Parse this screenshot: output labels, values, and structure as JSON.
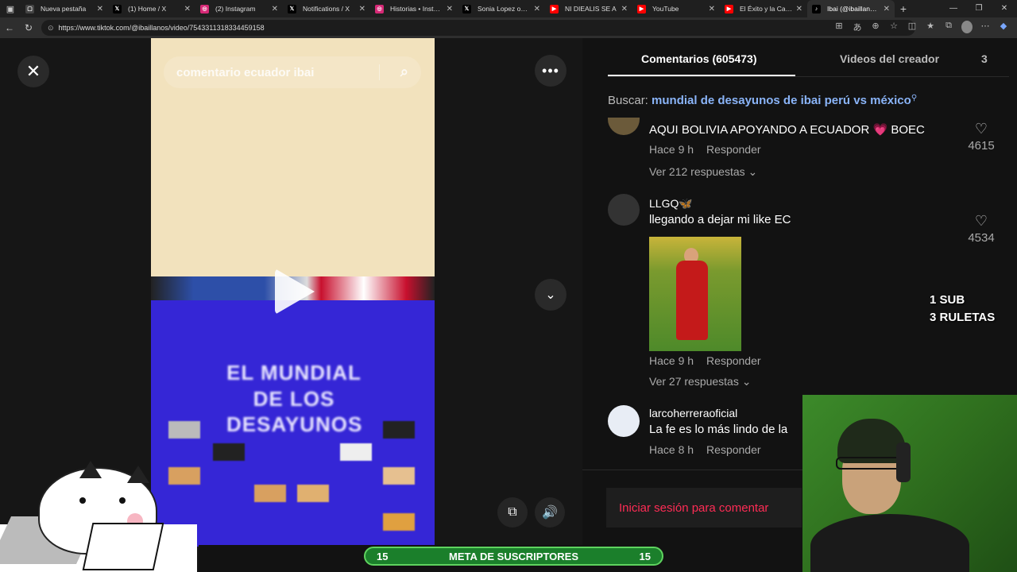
{
  "browser": {
    "tabs": [
      {
        "title": "Nueva pestaña",
        "icon": "new-tab",
        "color": "#444"
      },
      {
        "title": "(1) Home / X",
        "icon": "x",
        "color": "#000"
      },
      {
        "title": "(2) Instagram",
        "icon": "instagram",
        "color": "#d62976"
      },
      {
        "title": "Notifications / X",
        "icon": "x",
        "color": "#000"
      },
      {
        "title": "Historias • Instagram",
        "icon": "instagram",
        "color": "#d62976"
      },
      {
        "title": "Sonia Lopez on X:",
        "icon": "x",
        "color": "#000"
      },
      {
        "title": "NI DIEALIS SE A",
        "icon": "youtube",
        "color": "#ff0000"
      },
      {
        "title": "YouTube",
        "icon": "youtube",
        "color": "#ff0000"
      },
      {
        "title": "El Éxito y la Caída d",
        "icon": "youtube",
        "color": "#ff0000"
      },
      {
        "title": "Ibai (@ibaillanos) |",
        "icon": "tiktok",
        "color": "#000"
      }
    ],
    "url": "https://www.tiktok.com/@ibaillanos/video/7543311318334459158"
  },
  "video": {
    "search_text": "comentario ecuador ibai",
    "overlay_title": "EL MUNDIAL DE LOS DESAYUNOS"
  },
  "comments_panel": {
    "tab_comments": "Comentarios (605473)",
    "tab_creator_videos": "Videos del creador",
    "tab_extra": "3",
    "search_label": "Buscar: ",
    "search_query": "mundial de desayunos de ibai perú vs méxico",
    "comments": [
      {
        "name": "",
        "text": "AQUI BOLIVIA APOYANDO A ECUADOR 💗 BOEC",
        "time": "Hace 9 h",
        "reply": "Responder",
        "likes": "4615",
        "replies": "Ver 212 respuestas ⌄"
      },
      {
        "name": "LLGQ🦋",
        "text": "llegando a dejar mi like EC",
        "time": "Hace 9 h",
        "reply": "Responder",
        "likes": "4534",
        "replies": "Ver 27 respuestas ⌄"
      },
      {
        "name": "larcoherreraoficial",
        "text": "La fe es lo más lindo de la",
        "time": "Hace 8 h",
        "reply": "Responder",
        "likes": "",
        "replies": ""
      }
    ],
    "login_prompt": "Iniciar sesión para comentar"
  },
  "stream_overlay": {
    "line1": "1 SUB",
    "line2": "3 RULETAS",
    "goal_left": "15",
    "goal_label": "META DE SUSCRIPTORES",
    "goal_right": "15"
  }
}
